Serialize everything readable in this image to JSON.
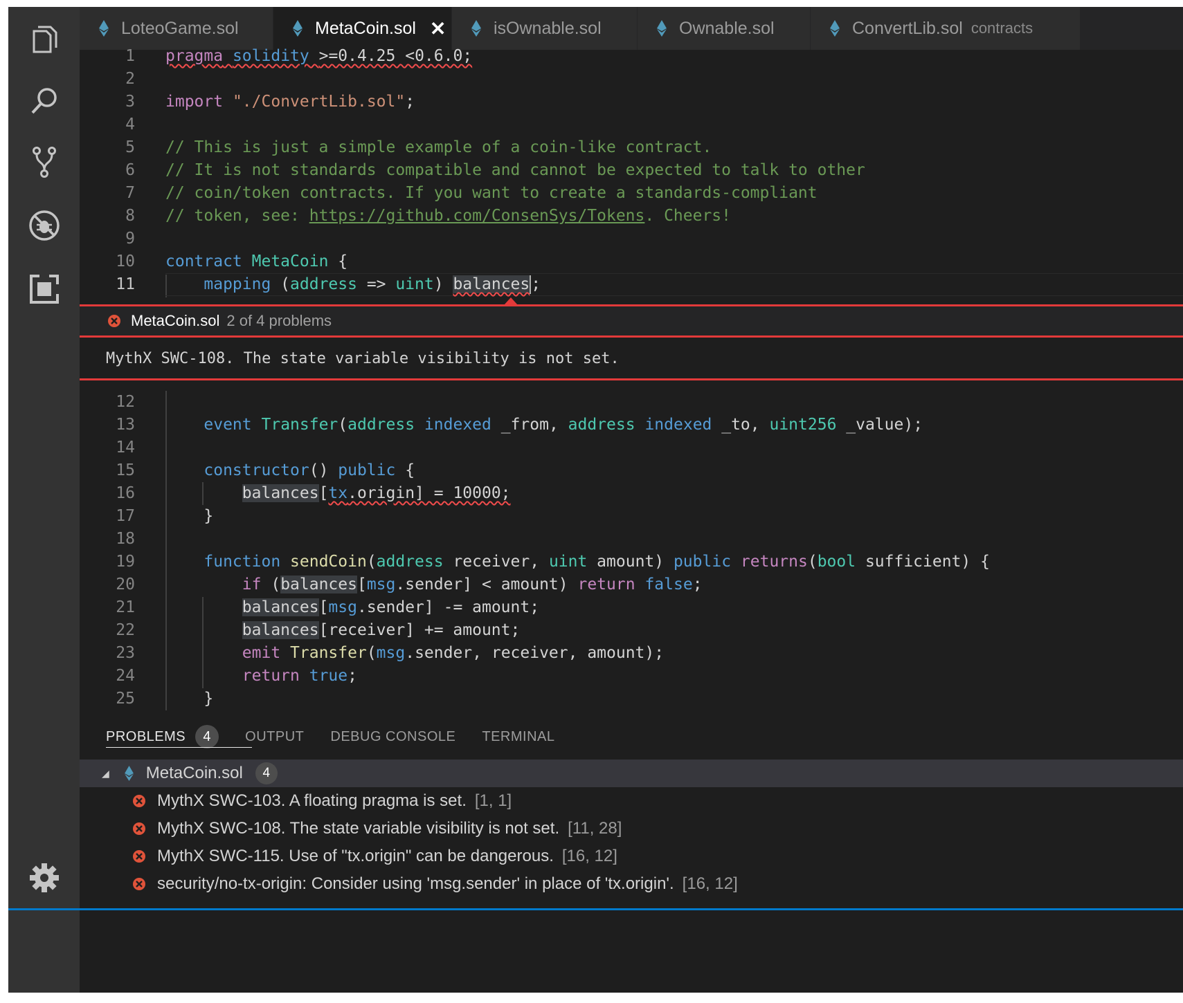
{
  "tabs": [
    {
      "name": "LoteoGame.sol",
      "active": false
    },
    {
      "name": "MetaCoin.sol",
      "active": true,
      "close": "✕"
    },
    {
      "name": "isOwnable.sol",
      "active": false
    },
    {
      "name": "Ownable.sol",
      "active": false
    },
    {
      "name": "ConvertLib.sol",
      "active": false,
      "description": "contracts"
    }
  ],
  "line_numbers": [
    "1",
    "2",
    "3",
    "4",
    "5",
    "6",
    "7",
    "8",
    "9",
    "10",
    "11",
    "12",
    "13",
    "14",
    "15",
    "16",
    "17",
    "18",
    "19",
    "20",
    "21",
    "22",
    "23",
    "24",
    "25"
  ],
  "code": {
    "l1": {
      "a": "pragma",
      "b": "solidity",
      "c": ">=0.4.25 <0.6.0;"
    },
    "l3": {
      "a": "import",
      "b": "\"./ConvertLib.sol\"",
      "c": ";"
    },
    "l5": "// This is just a simple example of a coin-like contract.",
    "l6": "// It is not standards compatible and cannot be expected to talk to other",
    "l7": "// coin/token contracts. If you want to create a standards-compliant",
    "l8": {
      "a": "// token, see: ",
      "b": "https://github.com/ConsenSys/Tokens",
      "c": ". Cheers!"
    },
    "l10": {
      "a": "contract",
      "b": "MetaCoin",
      "c": " {"
    },
    "l11": {
      "a": "mapping",
      "b": " (",
      "c": "address",
      "d": " => ",
      "e": "uint",
      "f": ") ",
      "g": "balances",
      "h": ";"
    },
    "l13": {
      "a": "event",
      "b": "Transfer",
      "c": "(",
      "d": "address",
      "e": "indexed",
      "f": " _from, ",
      "g": "address",
      "h": "indexed",
      "i": " _to, ",
      "j": "uint256",
      "k": " _value);"
    },
    "l15": {
      "a": "constructor",
      "b": "() ",
      "c": "public",
      "d": " {"
    },
    "l16": {
      "a": "balances",
      "b": "[",
      "c": "tx",
      "d": ".origin] = 10000;"
    },
    "l17": "}",
    "l19": {
      "a": "function",
      "b": "sendCoin",
      "c": "(",
      "d": "address",
      "e": " receiver, ",
      "f": "uint",
      "g": " amount) ",
      "h": "public",
      "i": "returns",
      "j": "(",
      "k": "bool",
      "l": " sufficient) {"
    },
    "l20": {
      "a": "if",
      "b": " (",
      "c": "balances",
      "d": "[",
      "e": "msg",
      "f": ".sender] < amount) ",
      "g": "return",
      "h": "false",
      "i": ";"
    },
    "l21": {
      "a": "balances",
      "b": "[",
      "c": "msg",
      "d": ".sender] -= amount;"
    },
    "l22": {
      "a": "balances",
      "b": "[receiver] += amount;"
    },
    "l23": {
      "a": "emit",
      "b": "Transfer",
      "c": "(",
      "d": "msg",
      "e": ".sender, receiver, amount);"
    },
    "l24": {
      "a": "return",
      "b": "true",
      "c": ";"
    },
    "l25": "}"
  },
  "peek": {
    "file": "MetaCoin.sol",
    "meta": "2 of 4 problems",
    "message": "MythX SWC-108. The state variable visibility is not set."
  },
  "panel": {
    "tabs": [
      "PROBLEMS",
      "OUTPUT",
      "DEBUG CONSOLE",
      "TERMINAL"
    ],
    "problem_count": "4",
    "file": {
      "name": "MetaCoin.sol",
      "count": "4"
    },
    "problems": [
      {
        "message": "MythX SWC-103. A floating pragma is set.",
        "location": "[1, 1]"
      },
      {
        "message": "MythX SWC-108. The state variable visibility is not set.",
        "location": "[11, 28]"
      },
      {
        "message": "MythX SWC-115. Use of \"tx.origin\" can be dangerous.",
        "location": "[16, 12]"
      },
      {
        "message": "security/no-tx-origin: Consider using 'msg.sender' in place of 'tx.origin'.",
        "location": "[16, 12]"
      }
    ]
  },
  "colors": {
    "error": "#e33a3a",
    "keyword": "#569cd6",
    "type": "#4ec9b0",
    "function": "#dcdcaa",
    "string": "#ce9178",
    "comment": "#6a9955",
    "control": "#c586c0"
  }
}
